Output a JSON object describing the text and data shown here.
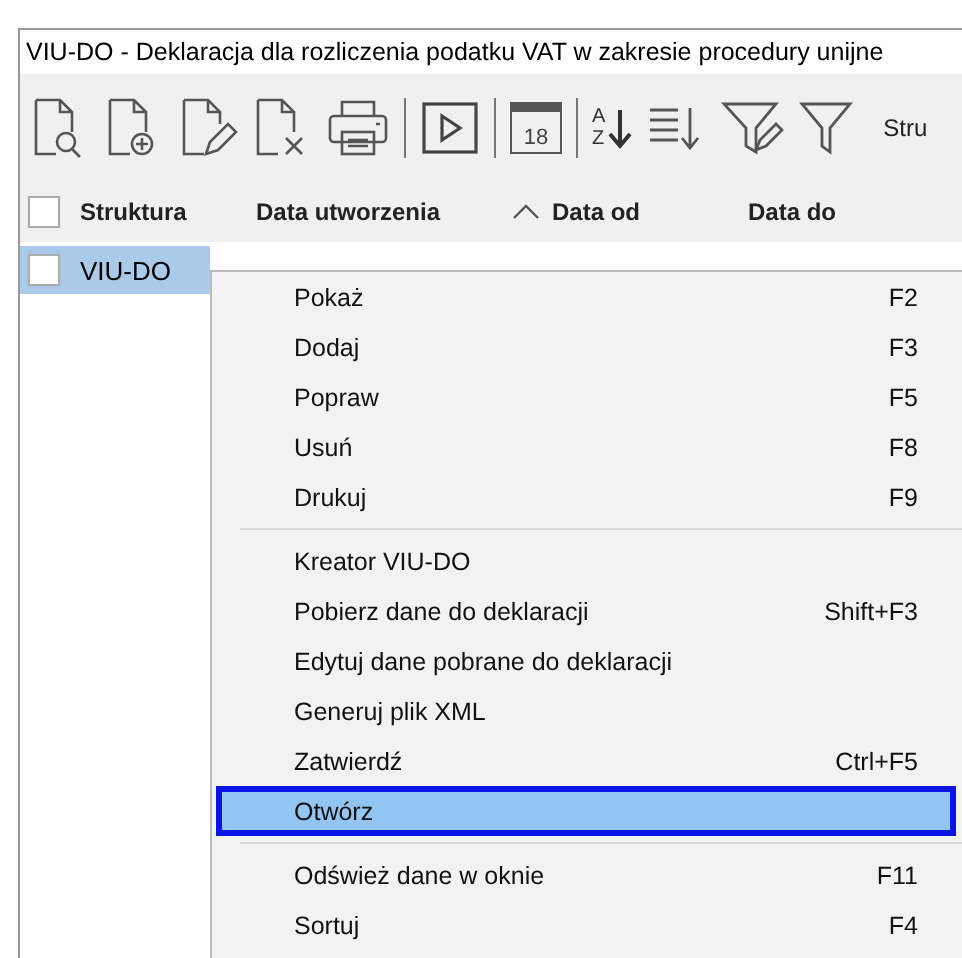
{
  "window": {
    "title": "VIU-DO - Deklaracja dla rozliczenia podatku VAT w zakresie procedury unijne"
  },
  "toolbar": [
    {
      "kind": "doc-search"
    },
    {
      "kind": "doc-add"
    },
    {
      "kind": "doc-edit"
    },
    {
      "kind": "doc-delete"
    },
    {
      "kind": "printer"
    },
    {
      "kind": "separator"
    },
    {
      "kind": "play"
    },
    {
      "kind": "separator"
    },
    {
      "kind": "calendar",
      "label": "18"
    },
    {
      "kind": "separator"
    },
    {
      "kind": "sort-az",
      "top": "A",
      "bottom": "Z"
    },
    {
      "kind": "sort-lines"
    },
    {
      "kind": "filter-edit"
    },
    {
      "kind": "filter"
    },
    {
      "kind": "text",
      "label": "Stru"
    }
  ],
  "table": {
    "all_checked": false,
    "columns": [
      {
        "label": "Struktura",
        "sorted": false
      },
      {
        "label": "Data utworzenia",
        "sorted": false
      },
      {
        "label": "Data od",
        "sorted": true
      },
      {
        "label": "Data do",
        "sorted": false
      }
    ],
    "rows": [
      {
        "cells": [
          "VIU-DO"
        ],
        "selected": true,
        "checked": false
      }
    ]
  },
  "context_menu": [
    {
      "kind": "item",
      "label": "Pokaż",
      "shortcut": "F2",
      "selected": false
    },
    {
      "kind": "item",
      "label": "Dodaj",
      "shortcut": "F3",
      "selected": false
    },
    {
      "kind": "item",
      "label": "Popraw",
      "shortcut": "F5",
      "selected": false
    },
    {
      "kind": "item",
      "label": "Usuń",
      "shortcut": "F8",
      "selected": false
    },
    {
      "kind": "item",
      "label": "Drukuj",
      "shortcut": "F9",
      "selected": false
    },
    {
      "kind": "separator"
    },
    {
      "kind": "item",
      "label": "Kreator VIU-DO",
      "selected": false
    },
    {
      "kind": "item",
      "label": "Pobierz dane do deklaracji",
      "shortcut": "Shift+F3",
      "selected": false
    },
    {
      "kind": "item",
      "label": "Edytuj dane pobrane do deklaracji",
      "selected": false
    },
    {
      "kind": "item",
      "label": "Generuj plik XML",
      "selected": false
    },
    {
      "kind": "item",
      "label": "Zatwierdź",
      "shortcut": "Ctrl+F5",
      "selected": false
    },
    {
      "kind": "item",
      "label": "Otwórz",
      "selected": true
    },
    {
      "kind": "separator"
    },
    {
      "kind": "item",
      "label": "Odśwież dane w oknie",
      "shortcut": "F11",
      "selected": false
    },
    {
      "kind": "item",
      "label": "Sortuj",
      "shortcut": "F4",
      "selected": false
    }
  ]
}
